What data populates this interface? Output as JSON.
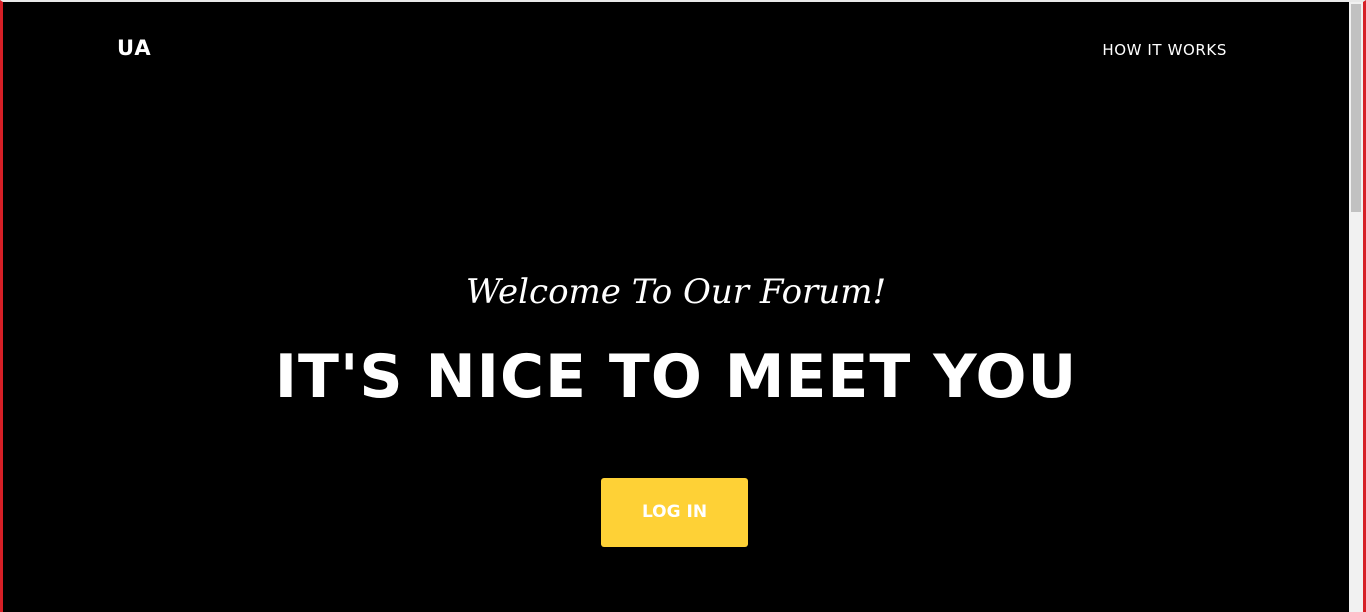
{
  "navbar": {
    "brand": "UA",
    "links": [
      {
        "label": "HOW IT WORKS"
      }
    ]
  },
  "hero": {
    "subheading": "Welcome To Our Forum!",
    "heading": "IT'S NICE TO MEET YOU",
    "cta_label": "LOG IN"
  },
  "colors": {
    "background": "#000000",
    "accent": "#fed136",
    "text": "#ffffff"
  }
}
